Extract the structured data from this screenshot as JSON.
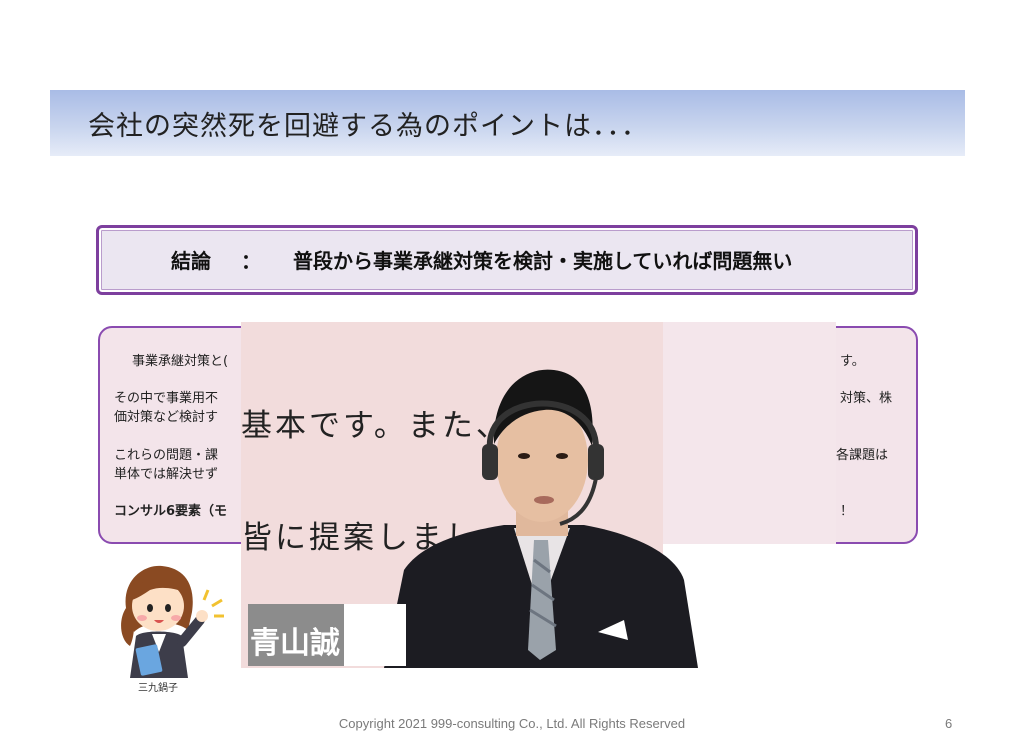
{
  "slide": {
    "title": "会社の突然死を回避する為のポイントは．．．",
    "conclusion": {
      "label": "結論",
      "colon": "：",
      "text": "普段から事業承継対策を検討・実施していれば問題無い"
    },
    "body_visible": {
      "line1_left": "事業承継対策と(",
      "line1_right": "す。",
      "line2_left": "その中で事業用不",
      "line2_right": "対策、株",
      "line3_left": "価対策など検討す",
      "line4_left": "これらの問題・課",
      "line4_right": "各課題は",
      "line5_left": "単体では解決せず",
      "line6_left": "コンサル6要素（モ",
      "line6_right": "！"
    },
    "character_name": "三九鍋子",
    "footer": "Copyright 2021  999-consulting Co., Ltd.  All Rights Reserved",
    "page_number": "6"
  },
  "video": {
    "caption_line1": "基本です。また、",
    "caption_line2": "皆に提案しましょう",
    "speaker_name": "青山誠"
  },
  "colors": {
    "title_bar": "#a9bce6",
    "conclusion_border": "#7d3f9e",
    "body_bg": "#f3e4ea",
    "video_bg": "#f2dcdc"
  }
}
